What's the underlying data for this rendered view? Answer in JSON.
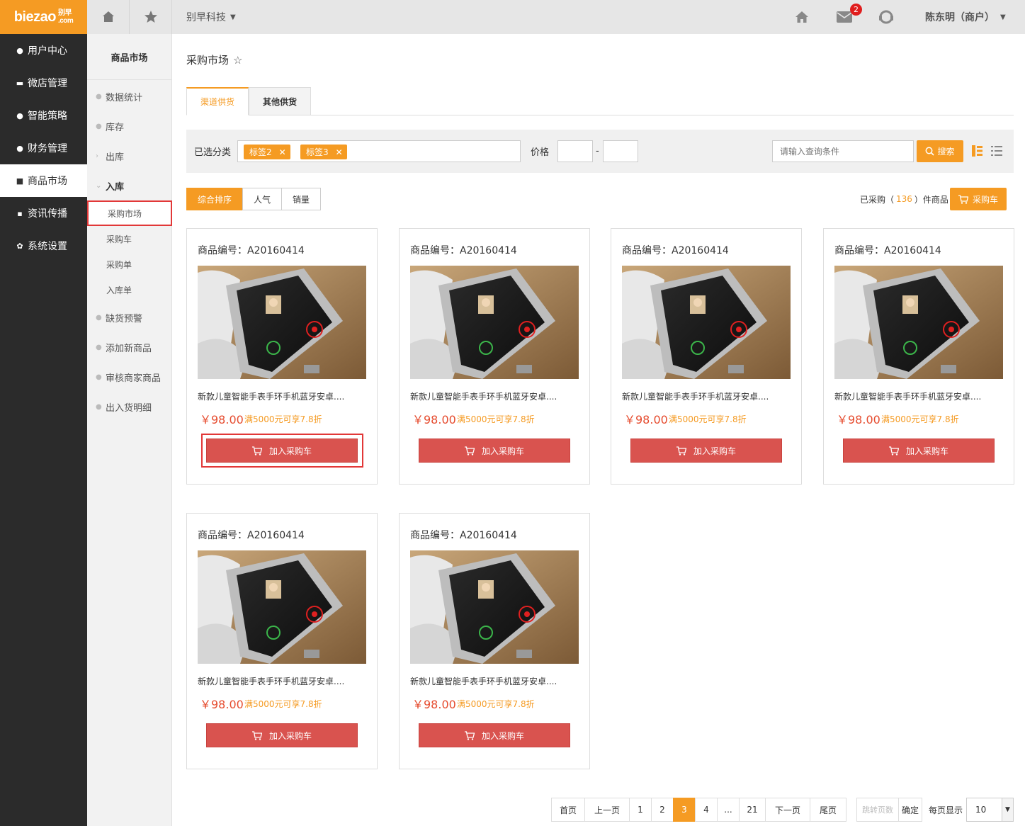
{
  "logo": {
    "text": "biezao",
    "sub_top": "别早",
    "sub_bottom": ".com"
  },
  "topbar": {
    "company": "别早科技",
    "mail_badge": "2",
    "user": "陈东明（商户）"
  },
  "sidebar": {
    "items": [
      {
        "label": "用户中心",
        "icon": "user-icon"
      },
      {
        "label": "微店管理",
        "icon": "shop-icon"
      },
      {
        "label": "智能策略",
        "icon": "bulb-icon"
      },
      {
        "label": "财务管理",
        "icon": "money-icon"
      },
      {
        "label": "商品市场",
        "icon": "market-icon"
      },
      {
        "label": "资讯传播",
        "icon": "grid-icon"
      },
      {
        "label": "系统设置",
        "icon": "gear-icon"
      }
    ]
  },
  "subnav": {
    "title": "商品市场",
    "items": [
      "数据统计",
      "库存",
      "出库",
      "入库"
    ],
    "children": [
      "采购市场",
      "采购车",
      "采购单",
      "入库单"
    ],
    "items_after": [
      "缺货预警",
      "添加新商品",
      "审核商家商品",
      "出入货明细"
    ]
  },
  "page": {
    "title": "采购市场",
    "tabs": [
      "渠道供货",
      "其他供货"
    ]
  },
  "filter": {
    "category_label": "已选分类",
    "tags": [
      "标签2",
      "标签3"
    ],
    "price_label": "价格",
    "price_dash": "-",
    "search_placeholder": "请输入查询条件",
    "search_button": "搜索"
  },
  "sort": {
    "buttons": [
      "综合排序",
      "人气",
      "销量"
    ]
  },
  "bought": {
    "prefix": "已采购（",
    "count": "136",
    "suffix": "）件商品",
    "cart_button": "采购车"
  },
  "products": [
    {
      "code": "商品编号：A20160414",
      "name": "新款儿童智能手表手环手机蓝牙安卓....",
      "price": "￥98.00",
      "promo": "满5000元可享7.8折",
      "button": "加入采购车"
    },
    {
      "code": "商品编号：A20160414",
      "name": "新款儿童智能手表手环手机蓝牙安卓....",
      "price": "￥98.00",
      "promo": "满5000元可享7.8折",
      "button": "加入采购车"
    },
    {
      "code": "商品编号：A20160414",
      "name": "新款儿童智能手表手环手机蓝牙安卓....",
      "price": "￥98.00",
      "promo": "满5000元可享7.8折",
      "button": "加入采购车"
    },
    {
      "code": "商品编号：A20160414",
      "name": "新款儿童智能手表手环手机蓝牙安卓....",
      "price": "￥98.00",
      "promo": "满5000元可享7.8折",
      "button": "加入采购车"
    },
    {
      "code": "商品编号：A20160414",
      "name": "新款儿童智能手表手环手机蓝牙安卓....",
      "price": "￥98.00",
      "promo": "满5000元可享7.8折",
      "button": "加入采购车"
    },
    {
      "code": "商品编号：A20160414",
      "name": "新款儿童智能手表手环手机蓝牙安卓....",
      "price": "￥98.00",
      "promo": "满5000元可享7.8折",
      "button": "加入采购车"
    }
  ],
  "pager": {
    "pages": [
      "首页",
      "上一页",
      "1",
      "2",
      "3",
      "4",
      "...",
      "21",
      "下一页",
      "尾页"
    ],
    "current": "3",
    "jump_placeholder": "跳转页数",
    "confirm": "确定",
    "per_page_label": "每页显示",
    "per_page_value": "10"
  },
  "colors": {
    "accent": "#f59b23",
    "danger": "#d9534f",
    "sidebar": "#2b2b2b"
  }
}
